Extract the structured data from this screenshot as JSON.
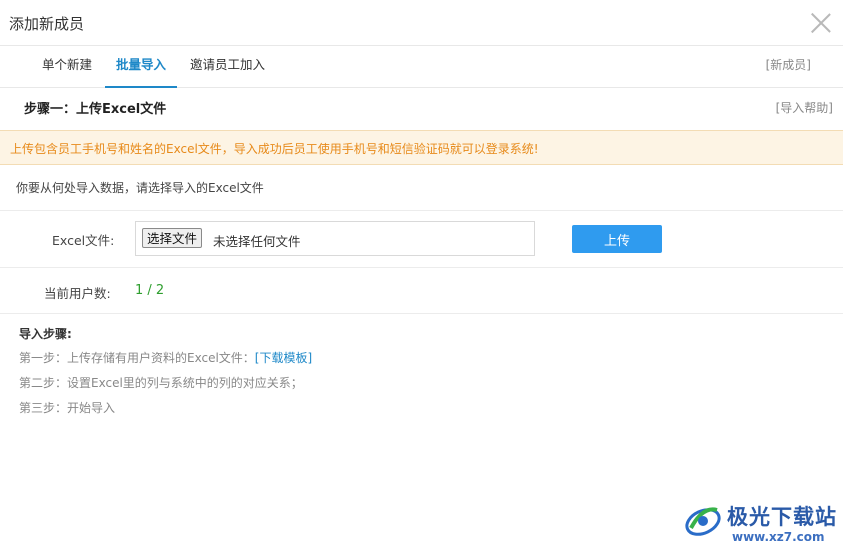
{
  "dialog": {
    "title": "添加新成员"
  },
  "tabs": [
    {
      "label": "单个新建",
      "active": false
    },
    {
      "label": "批量导入",
      "active": true
    },
    {
      "label": "邀请员工加入",
      "active": false
    }
  ],
  "tab_link": "[新成员]",
  "step": {
    "title": "步骤一：上传Excel文件",
    "help": "[导入帮助]"
  },
  "notice": "上传包含员工手机号和姓名的Excel文件，导入成功后员工使用手机号和短信验证码就可以登录系统!",
  "prompt": "你要从何处导入数据，请选择导入的Excel文件",
  "file": {
    "label": "Excel文件:",
    "choose": "选择文件",
    "no_file": "未选择任何文件",
    "upload": "上传"
  },
  "users": {
    "label": "当前用户数:",
    "value": "1 / 2"
  },
  "import_steps": {
    "title": "导入步骤:",
    "step1": "第一步：上传存储有用户资料的Excel文件：",
    "step1_link": "[下载模板]",
    "step2": "第二步：设置Excel里的列与系统中的列的对应关系；",
    "step3": "第三步：开始导入"
  },
  "watermark": {
    "name": "极光下载站",
    "url": "www.xz7.com"
  },
  "colors": {
    "accent": "#1e88c8",
    "button": "#2f9bef",
    "notice_text": "#e78a1a",
    "count": "#2e9e2e"
  }
}
